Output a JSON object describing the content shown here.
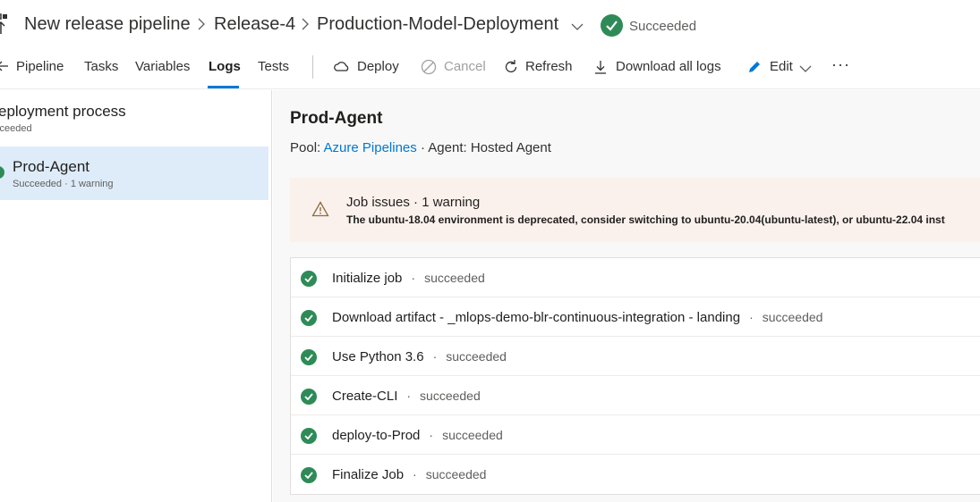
{
  "header": {
    "breadcrumb": [
      "New release pipeline",
      "Release-4",
      "Production-Model-Deployment"
    ],
    "status": "Succeeded"
  },
  "tabs": {
    "pipeline": "Pipeline",
    "tasks": "Tasks",
    "variables": "Variables",
    "logs": "Logs",
    "tests": "Tests"
  },
  "actions": {
    "deploy": "Deploy",
    "cancel": "Cancel",
    "refresh": "Refresh",
    "download": "Download all logs",
    "edit": "Edit",
    "more": "···"
  },
  "left": {
    "title": "eployment process",
    "subtitle": "cceeded",
    "item_title": "Prod-Agent",
    "item_subtitle": "Succeeded · 1 warning"
  },
  "main": {
    "job_title": "Prod-Agent",
    "pool_label": "Pool:",
    "pool_value": "Azure Pipelines",
    "agent_text": "· Agent: Hosted Agent",
    "issue_title": "Job issues · 1 warning",
    "issue_message": "The ubuntu-18.04 environment is deprecated, consider switching to ubuntu-20.04(ubuntu-latest), or ubuntu-22.04 inst"
  },
  "steps": [
    {
      "name": "Initialize job",
      "status": "succeeded"
    },
    {
      "name": "Download artifact - _mlops-demo-blr-continuous-integration - landing",
      "status": "succeeded"
    },
    {
      "name": "Use Python 3.6",
      "status": "succeeded"
    },
    {
      "name": "Create-CLI",
      "status": "succeeded"
    },
    {
      "name": "deploy-to-Prod",
      "status": "succeeded"
    },
    {
      "name": "Finalize Job",
      "status": "succeeded"
    }
  ],
  "colors": {
    "accent": "#0078d4",
    "success": "#2e8b57",
    "warning_bg": "#fbf1ec",
    "selected_bg": "#deecf9"
  }
}
